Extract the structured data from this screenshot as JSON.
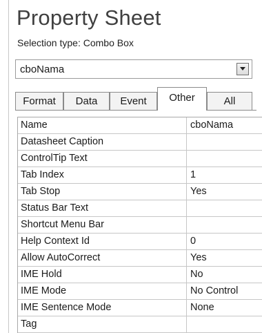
{
  "header": {
    "title": "Property Sheet",
    "selection_type": "Selection type:  Combo Box"
  },
  "object_selector": {
    "value": "cboNama",
    "dropdown_icon": "chevron-down-icon"
  },
  "tabs": [
    {
      "label": "Format",
      "active": false
    },
    {
      "label": "Data",
      "active": false
    },
    {
      "label": "Event",
      "active": false
    },
    {
      "label": "Other",
      "active": true
    },
    {
      "label": "All",
      "active": false
    }
  ],
  "properties": [
    {
      "name": "Name",
      "value": "cboNama"
    },
    {
      "name": "Datasheet Caption",
      "value": ""
    },
    {
      "name": "ControlTip Text",
      "value": ""
    },
    {
      "name": "Tab Index",
      "value": "1"
    },
    {
      "name": "Tab Stop",
      "value": "Yes"
    },
    {
      "name": "Status Bar Text",
      "value": ""
    },
    {
      "name": "Shortcut Menu Bar",
      "value": ""
    },
    {
      "name": "Help Context Id",
      "value": "0"
    },
    {
      "name": "Allow AutoCorrect",
      "value": "Yes"
    },
    {
      "name": "IME Hold",
      "value": "No"
    },
    {
      "name": "IME Mode",
      "value": "No Control"
    },
    {
      "name": "IME Sentence Mode",
      "value": "None"
    },
    {
      "name": "Tag",
      "value": ""
    }
  ]
}
